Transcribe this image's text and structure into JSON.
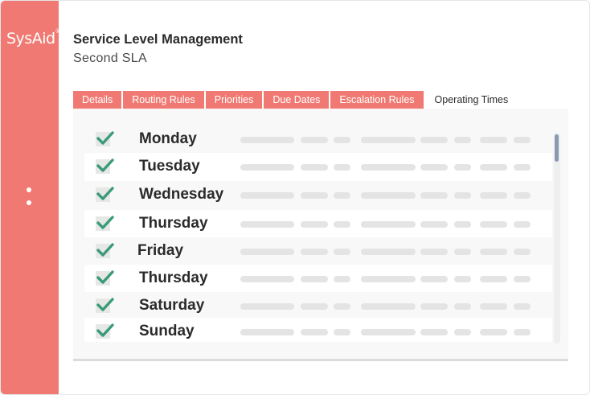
{
  "brand": {
    "logo_text": "SysAid",
    "accent": "#f07a73"
  },
  "header": {
    "title": "Service Level Management",
    "subtitle": "Second SLA"
  },
  "tabs": [
    {
      "label": "Details",
      "active": false
    },
    {
      "label": "Routing Rules",
      "active": false
    },
    {
      "label": "Priorities",
      "active": false
    },
    {
      "label": "Due Dates",
      "active": false
    },
    {
      "label": "Escalation Rules",
      "active": false
    },
    {
      "label": "Operating Times",
      "active": true
    }
  ],
  "days": [
    {
      "label": "Monday",
      "checked": true
    },
    {
      "label": "Tuesday",
      "checked": true
    },
    {
      "label": "Wednesday",
      "checked": true
    },
    {
      "label": "Thursday",
      "checked": true
    },
    {
      "label": "Friday",
      "checked": true
    },
    {
      "label": "Thursday",
      "checked": true
    },
    {
      "label": "Saturday",
      "checked": true
    },
    {
      "label": "Sunday",
      "checked": true
    }
  ],
  "colors": {
    "check": "#3a9a7a",
    "placeholder": "#e3e4e3",
    "scroll_thumb": "#8a9ab0"
  }
}
